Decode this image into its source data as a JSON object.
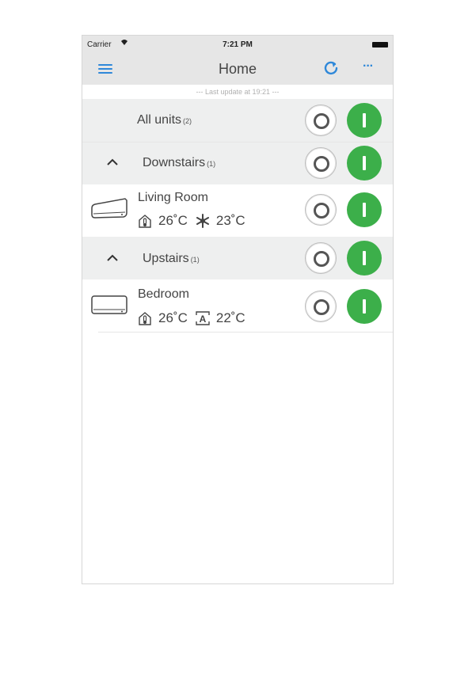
{
  "status_bar": {
    "carrier": "Carrier",
    "time": "7:21 PM"
  },
  "nav": {
    "title": "Home",
    "more_label": "···"
  },
  "last_update": "--- Last update at 19:21 ---",
  "all_units": {
    "label": "All units",
    "count": "(2)"
  },
  "groups": [
    {
      "label": "Downstairs",
      "count": "(1)",
      "units": [
        {
          "name": "Living Room",
          "room_temp": "26˚C",
          "mode_icon": "snowflake-icon",
          "set_temp": "23˚C"
        }
      ]
    },
    {
      "label": "Upstairs",
      "count": "(1)",
      "units": [
        {
          "name": "Bedroom",
          "room_temp": "26˚C",
          "mode_icon": "auto-mode-icon",
          "mode_glyph": "A",
          "set_temp": "22˚C"
        }
      ]
    }
  ],
  "colors": {
    "accent": "#2f88d9",
    "on_button": "#3caf4a",
    "row_gray": "#eeefef",
    "bar_gray": "#e6e6e6"
  }
}
